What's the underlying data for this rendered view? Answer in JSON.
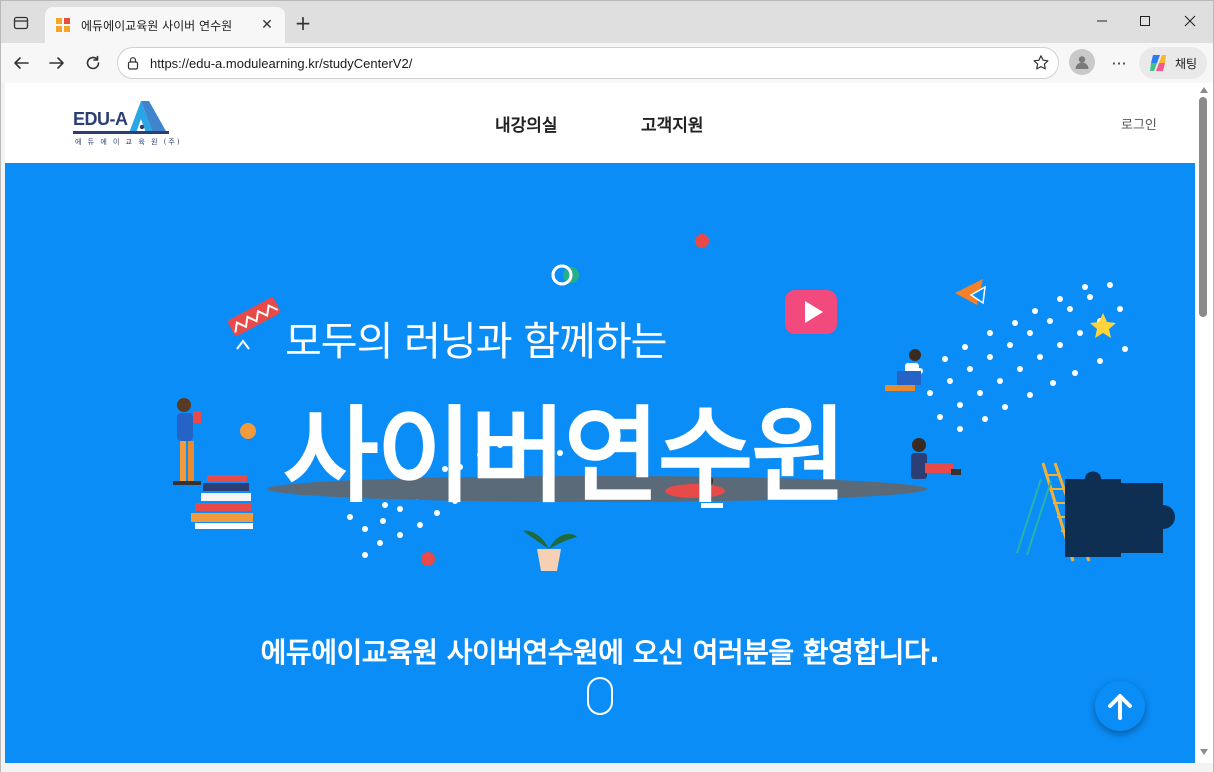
{
  "browser": {
    "tab": {
      "title": "에듀에이교육원 사이버 연수원",
      "favicon": "edu-a-favicon"
    },
    "address": {
      "url": "https://edu-a.modulearning.kr/studyCenterV2/"
    },
    "copilot_label": "채팅",
    "icons": {
      "tab_actions": "tab-actions-icon",
      "close_tab": "close-icon",
      "new_tab": "plus-icon",
      "minimize": "minimize-icon",
      "maximize": "maximize-icon",
      "close_window": "close-icon",
      "back": "back-arrow-icon",
      "forward": "forward-arrow-icon",
      "reload": "reload-icon",
      "site_info": "lock-icon",
      "favorite": "star-icon",
      "profile": "profile-icon",
      "more": "more-icon",
      "copilot": "copilot-icon"
    }
  },
  "site": {
    "logo": {
      "text": "EDU-A",
      "subtext": "에 듀 에 이 교 육 원 (주)"
    },
    "nav": [
      {
        "label": "내강의실"
      },
      {
        "label": "고객지원"
      }
    ],
    "login_label": "로그인",
    "hero": {
      "subtitle": "모두의 러닝과 함께하는",
      "title": "사이버연수원",
      "welcome": "에듀에이교육원 사이버연수원에 오신 여러분을 환영합니다.",
      "background_color": "#0b8df7"
    },
    "top_button_icon": "arrow-up-icon"
  }
}
